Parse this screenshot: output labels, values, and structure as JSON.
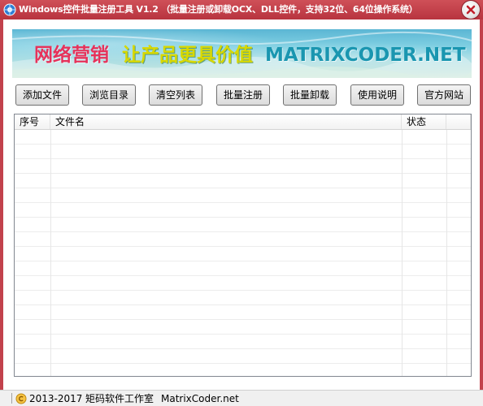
{
  "window": {
    "title": "Windows控件批量注册工具 V1.2 （批量注册或卸载OCX、DLL控件，支持32位、64位操作系统）",
    "close_icon": "close-icon",
    "app_icon": "gear-globe-icon"
  },
  "banner": {
    "slogan_part1": "网络营销",
    "slogan_part2": "让产品更具价值",
    "brand": "MATRIXCODER.NET",
    "colors": {
      "part1": "#e6325a",
      "part2": "#d8d800",
      "brand": "#1a96b0"
    }
  },
  "toolbar": {
    "buttons": [
      {
        "label": "添加文件"
      },
      {
        "label": "浏览目录"
      },
      {
        "label": "清空列表"
      },
      {
        "label": "批量注册"
      },
      {
        "label": "批量卸载"
      },
      {
        "label": "使用说明"
      },
      {
        "label": "官方网站"
      }
    ]
  },
  "file_list": {
    "columns": [
      "序号",
      "文件名",
      "状态",
      ""
    ],
    "rows": []
  },
  "statusbar": {
    "copyright_icon": "copyright-icon",
    "years": "2013-2017",
    "studio": "矩码软件工作室",
    "website": "MatrixCoder.net"
  },
  "theme": {
    "titlebar": "#c2424c",
    "button_border": "#707070"
  }
}
